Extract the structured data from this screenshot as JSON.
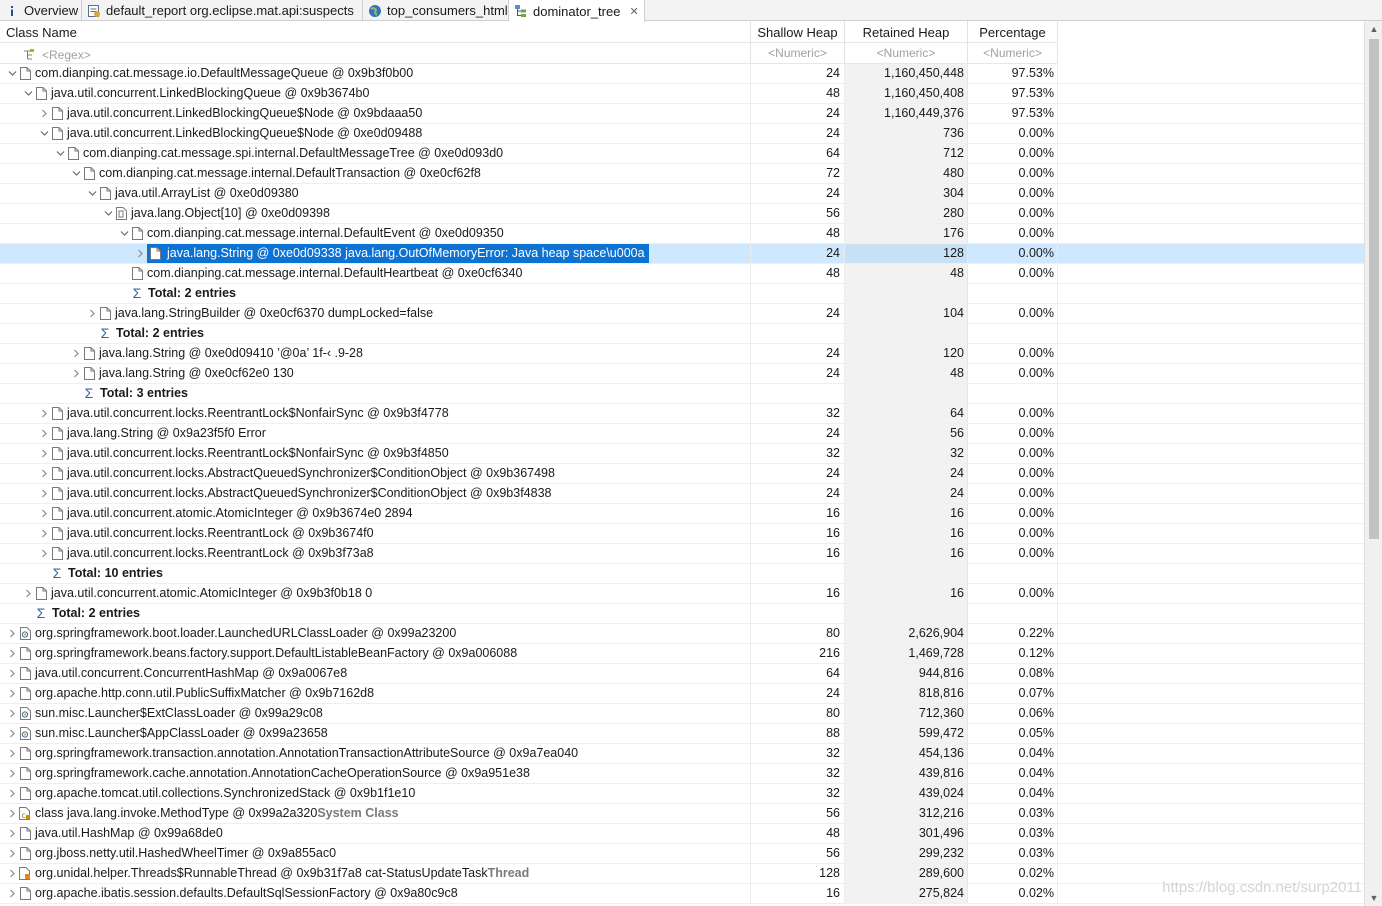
{
  "tabs": [
    {
      "label": "Overview",
      "icon": "info-icon",
      "active": false
    },
    {
      "label": "default_report  org.eclipse.mat.api:suspects",
      "icon": "report-icon",
      "active": false
    },
    {
      "label": "top_consumers_html",
      "icon": "globe-icon",
      "active": false
    },
    {
      "label": "dominator_tree",
      "icon": "tree-icon",
      "active": true
    }
  ],
  "table": {
    "headers": [
      "Class Name",
      "Shallow Heap",
      "Retained Heap",
      "Percentage"
    ],
    "filters": [
      "<Regex>",
      "<Numeric>",
      "<Numeric>",
      "<Numeric>"
    ],
    "rows": [
      {
        "depth": 0,
        "expander": "open",
        "icon": "file",
        "name": "com.dianping.cat.message.io.DefaultMessageQueue @ 0x9b3f0b00",
        "shallow": "24",
        "retained": "1,160,450,448",
        "pct": "97.53%"
      },
      {
        "depth": 1,
        "expander": "open",
        "icon": "file",
        "name": "java.util.concurrent.LinkedBlockingQueue @ 0x9b3674b0",
        "shallow": "48",
        "retained": "1,160,450,408",
        "pct": "97.53%"
      },
      {
        "depth": 2,
        "expander": "closed",
        "icon": "file",
        "name": "java.util.concurrent.LinkedBlockingQueue$Node @ 0x9bdaaa50",
        "shallow": "24",
        "retained": "1,160,449,376",
        "pct": "97.53%"
      },
      {
        "depth": 2,
        "expander": "open",
        "icon": "file",
        "name": "java.util.concurrent.LinkedBlockingQueue$Node @ 0xe0d09488",
        "shallow": "24",
        "retained": "736",
        "pct": "0.00%"
      },
      {
        "depth": 3,
        "expander": "open",
        "icon": "file",
        "name": "com.dianping.cat.message.spi.internal.DefaultMessageTree @ 0xe0d093d0",
        "shallow": "64",
        "retained": "712",
        "pct": "0.00%"
      },
      {
        "depth": 4,
        "expander": "open",
        "icon": "file",
        "name": "com.dianping.cat.message.internal.DefaultTransaction @ 0xe0cf62f8",
        "shallow": "72",
        "retained": "480",
        "pct": "0.00%"
      },
      {
        "depth": 5,
        "expander": "open",
        "icon": "file",
        "name": "java.util.ArrayList @ 0xe0d09380",
        "shallow": "24",
        "retained": "304",
        "pct": "0.00%"
      },
      {
        "depth": 6,
        "expander": "open",
        "icon": "array",
        "name": "java.lang.Object[10] @ 0xe0d09398",
        "shallow": "56",
        "retained": "280",
        "pct": "0.00%"
      },
      {
        "depth": 7,
        "expander": "open",
        "icon": "file",
        "name": "com.dianping.cat.message.internal.DefaultEvent @ 0xe0d09350",
        "shallow": "48",
        "retained": "176",
        "pct": "0.00%"
      },
      {
        "depth": 8,
        "expander": "closed",
        "icon": "file",
        "name": "java.lang.String @ 0xe0d09338  java.lang.OutOfMemoryError: Java heap space\\u000a",
        "shallow": "24",
        "retained": "128",
        "pct": "0.00%",
        "selected": true
      },
      {
        "depth": 7,
        "expander": "none",
        "icon": "file",
        "name": "com.dianping.cat.message.internal.DefaultHeartbeat @ 0xe0cf6340",
        "shallow": "48",
        "retained": "48",
        "pct": "0.00%"
      },
      {
        "depth": 7,
        "expander": "none",
        "icon": "sigma",
        "name": "Total: 2 entries",
        "bold": true,
        "shallow": "",
        "retained": "",
        "pct": ""
      },
      {
        "depth": 5,
        "expander": "closed",
        "icon": "file",
        "name": "java.lang.StringBuilder @ 0xe0cf6370  dumpLocked=false",
        "shallow": "24",
        "retained": "104",
        "pct": "0.00%"
      },
      {
        "depth": 5,
        "expander": "none",
        "icon": "sigma",
        "name": "Total: 2 entries",
        "bold": true,
        "shallow": "",
        "retained": "",
        "pct": ""
      },
      {
        "depth": 4,
        "expander": "closed",
        "icon": "file",
        "name": "java.lang.String @ 0xe0d09410                                  ’@0a’      1f-‹       .9-28",
        "shallow": "24",
        "retained": "120",
        "pct": "0.00%"
      },
      {
        "depth": 4,
        "expander": "closed",
        "icon": "file",
        "name": "java.lang.String @ 0xe0cf62e0  130",
        "shallow": "24",
        "retained": "48",
        "pct": "0.00%"
      },
      {
        "depth": 4,
        "expander": "none",
        "icon": "sigma",
        "name": "Total: 3 entries",
        "bold": true,
        "shallow": "",
        "retained": "",
        "pct": ""
      },
      {
        "depth": 2,
        "expander": "closed",
        "icon": "file",
        "name": "java.util.concurrent.locks.ReentrantLock$NonfairSync @ 0x9b3f4778",
        "shallow": "32",
        "retained": "64",
        "pct": "0.00%"
      },
      {
        "depth": 2,
        "expander": "closed",
        "icon": "file",
        "name": "java.lang.String @ 0x9a23f5f0  Error",
        "shallow": "24",
        "retained": "56",
        "pct": "0.00%"
      },
      {
        "depth": 2,
        "expander": "closed",
        "icon": "file",
        "name": "java.util.concurrent.locks.ReentrantLock$NonfairSync @ 0x9b3f4850",
        "shallow": "32",
        "retained": "32",
        "pct": "0.00%"
      },
      {
        "depth": 2,
        "expander": "closed",
        "icon": "file",
        "name": "java.util.concurrent.locks.AbstractQueuedSynchronizer$ConditionObject @ 0x9b367498",
        "shallow": "24",
        "retained": "24",
        "pct": "0.00%"
      },
      {
        "depth": 2,
        "expander": "closed",
        "icon": "file",
        "name": "java.util.concurrent.locks.AbstractQueuedSynchronizer$ConditionObject @ 0x9b3f4838",
        "shallow": "24",
        "retained": "24",
        "pct": "0.00%"
      },
      {
        "depth": 2,
        "expander": "closed",
        "icon": "file",
        "name": "java.util.concurrent.atomic.AtomicInteger @ 0x9b3674e0  2894",
        "shallow": "16",
        "retained": "16",
        "pct": "0.00%"
      },
      {
        "depth": 2,
        "expander": "closed",
        "icon": "file",
        "name": "java.util.concurrent.locks.ReentrantLock @ 0x9b3674f0",
        "shallow": "16",
        "retained": "16",
        "pct": "0.00%"
      },
      {
        "depth": 2,
        "expander": "closed",
        "icon": "file",
        "name": "java.util.concurrent.locks.ReentrantLock @ 0x9b3f73a8",
        "shallow": "16",
        "retained": "16",
        "pct": "0.00%"
      },
      {
        "depth": 2,
        "expander": "none",
        "icon": "sigma",
        "name": "Total: 10 entries",
        "bold": true,
        "shallow": "",
        "retained": "",
        "pct": ""
      },
      {
        "depth": 1,
        "expander": "closed",
        "icon": "file",
        "name": "java.util.concurrent.atomic.AtomicInteger @ 0x9b3f0b18  0",
        "shallow": "16",
        "retained": "16",
        "pct": "0.00%"
      },
      {
        "depth": 1,
        "expander": "none",
        "icon": "sigma",
        "name": "Total: 2 entries",
        "bold": true,
        "shallow": "",
        "retained": "",
        "pct": ""
      },
      {
        "depth": 0,
        "expander": "closed",
        "icon": "classloader",
        "name": "org.springframework.boot.loader.LaunchedURLClassLoader @ 0x99a23200",
        "shallow": "80",
        "retained": "2,626,904",
        "pct": "0.22%"
      },
      {
        "depth": 0,
        "expander": "closed",
        "icon": "file",
        "name": "org.springframework.beans.factory.support.DefaultListableBeanFactory @ 0x9a006088",
        "shallow": "216",
        "retained": "1,469,728",
        "pct": "0.12%"
      },
      {
        "depth": 0,
        "expander": "closed",
        "icon": "file",
        "name": "java.util.concurrent.ConcurrentHashMap @ 0x9a0067e8",
        "shallow": "64",
        "retained": "944,816",
        "pct": "0.08%"
      },
      {
        "depth": 0,
        "expander": "closed",
        "icon": "file",
        "name": "org.apache.http.conn.util.PublicSuffixMatcher @ 0x9b7162d8",
        "shallow": "24",
        "retained": "818,816",
        "pct": "0.07%"
      },
      {
        "depth": 0,
        "expander": "closed",
        "icon": "classloader",
        "name": "sun.misc.Launcher$ExtClassLoader @ 0x99a29c08",
        "shallow": "80",
        "retained": "712,360",
        "pct": "0.06%"
      },
      {
        "depth": 0,
        "expander": "closed",
        "icon": "classloader",
        "name": "sun.misc.Launcher$AppClassLoader @ 0x99a23658",
        "shallow": "88",
        "retained": "599,472",
        "pct": "0.05%"
      },
      {
        "depth": 0,
        "expander": "closed",
        "icon": "file",
        "name": "org.springframework.transaction.annotation.AnnotationTransactionAttributeSource @ 0x9a7ea040",
        "shallow": "32",
        "retained": "454,136",
        "pct": "0.04%"
      },
      {
        "depth": 0,
        "expander": "closed",
        "icon": "file",
        "name": "org.springframework.cache.annotation.AnnotationCacheOperationSource @ 0x9a951e38",
        "shallow": "32",
        "retained": "439,816",
        "pct": "0.04%"
      },
      {
        "depth": 0,
        "expander": "closed",
        "icon": "file",
        "name": "org.apache.tomcat.util.collections.SynchronizedStack @ 0x9b1f1e10",
        "shallow": "32",
        "retained": "439,024",
        "pct": "0.04%"
      },
      {
        "depth": 0,
        "expander": "closed",
        "icon": "sysclass",
        "name": "class java.lang.invoke.MethodType @ 0x99a2a320 ",
        "suffix": "System Class",
        "shallow": "56",
        "retained": "312,216",
        "pct": "0.03%"
      },
      {
        "depth": 0,
        "expander": "closed",
        "icon": "file",
        "name": "java.util.HashMap @ 0x99a68de0",
        "shallow": "48",
        "retained": "301,496",
        "pct": "0.03%"
      },
      {
        "depth": 0,
        "expander": "closed",
        "icon": "file",
        "name": "org.jboss.netty.util.HashedWheelTimer @ 0x9a855ac0",
        "shallow": "56",
        "retained": "299,232",
        "pct": "0.03%"
      },
      {
        "depth": 0,
        "expander": "closed",
        "icon": "thread",
        "name": "org.unidal.helper.Threads$RunnableThread @ 0x9b31f7a8  cat-StatusUpdateTask ",
        "suffix": "Thread",
        "shallow": "128",
        "retained": "289,600",
        "pct": "0.02%"
      },
      {
        "depth": 0,
        "expander": "closed",
        "icon": "file",
        "name": "org.apache.ibatis.session.defaults.DefaultSqlSessionFactory @ 0x9a80c9c8",
        "shallow": "16",
        "retained": "275,824",
        "pct": "0.02%"
      }
    ]
  },
  "watermark": "https://blog.csdn.net/surp2011",
  "colors": {
    "selection": "#0c73d4",
    "row_selected": "#cde8ff",
    "retained_column_bg": "#f2f2f2"
  }
}
